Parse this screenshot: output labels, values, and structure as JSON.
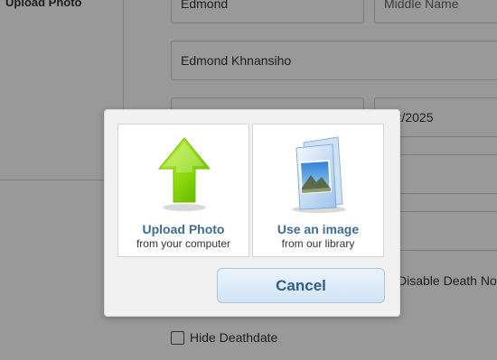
{
  "form": {
    "upload_photo_label": "Upload Photo",
    "first_name_value": "Edmond",
    "middle_name_placeholder": "Middle Name",
    "full_name_value": "Edmond Khnansiho",
    "date_value": "/12/2025",
    "disable_death_notice_label": "Disable Death No",
    "hide_deathdate_label": "Hide Deathdate"
  },
  "modal": {
    "upload_option": {
      "icon": "green-up-arrow-icon",
      "title": "Upload Photo",
      "subtitle": "from your computer"
    },
    "library_option": {
      "icon": "photo-library-icon",
      "title": "Use an image",
      "subtitle": "from our library"
    },
    "cancel_label": "Cancel"
  },
  "colors": {
    "overlay": "#000000",
    "option_title": "#3d6c94",
    "cancel_text": "#2f5f8a",
    "arrow_green": "#8bd80a"
  }
}
